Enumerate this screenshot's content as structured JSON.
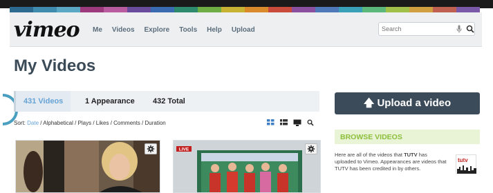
{
  "brand": {
    "logo": "vimeo",
    "stripe_colors": [
      "#2c6a8f",
      "#3f8cae",
      "#5aa8c4",
      "#9c3a7d",
      "#b85c9f",
      "#6a4c9c",
      "#3a6bb0",
      "#2e8a6d",
      "#6fae45",
      "#c8b233",
      "#d98a2b",
      "#c94b3b",
      "#8a4f9e",
      "#4e78b8",
      "#3aa0b8",
      "#5cb87a",
      "#a0c04a",
      "#d0a040",
      "#c06050",
      "#7a5aa8"
    ]
  },
  "nav": {
    "items": [
      "Me",
      "Videos",
      "Explore",
      "Tools",
      "Help",
      "Upload"
    ]
  },
  "search": {
    "placeholder": "Search"
  },
  "page": {
    "title": "My Videos"
  },
  "tabs": [
    "431 Videos",
    "1 Appearance",
    "432 Total"
  ],
  "sort": {
    "label": "Sort:",
    "options": [
      "Date",
      "Alphabetical",
      "Plays",
      "Likes",
      "Comments",
      "Duration"
    ]
  },
  "sidebar": {
    "upload_label": "Upload a video",
    "browse_title": "BROWSE VIDEOS",
    "browse_desc_pre": "Here are all of the videos that ",
    "browse_desc_name": "TUTV",
    "browse_desc_post": " has uploaded to Vimeo. Appearances are videos that TUTV has been credited in by others.",
    "tutv_logo_text": "tutv"
  },
  "thumb_b": {
    "live_tag": "LIVE"
  },
  "colors": {
    "accent_blue": "#66a3d6",
    "nav_text": "#5b6d7c",
    "upload_bg": "#3c4b5a",
    "browse_green": "#8cbf3a"
  }
}
